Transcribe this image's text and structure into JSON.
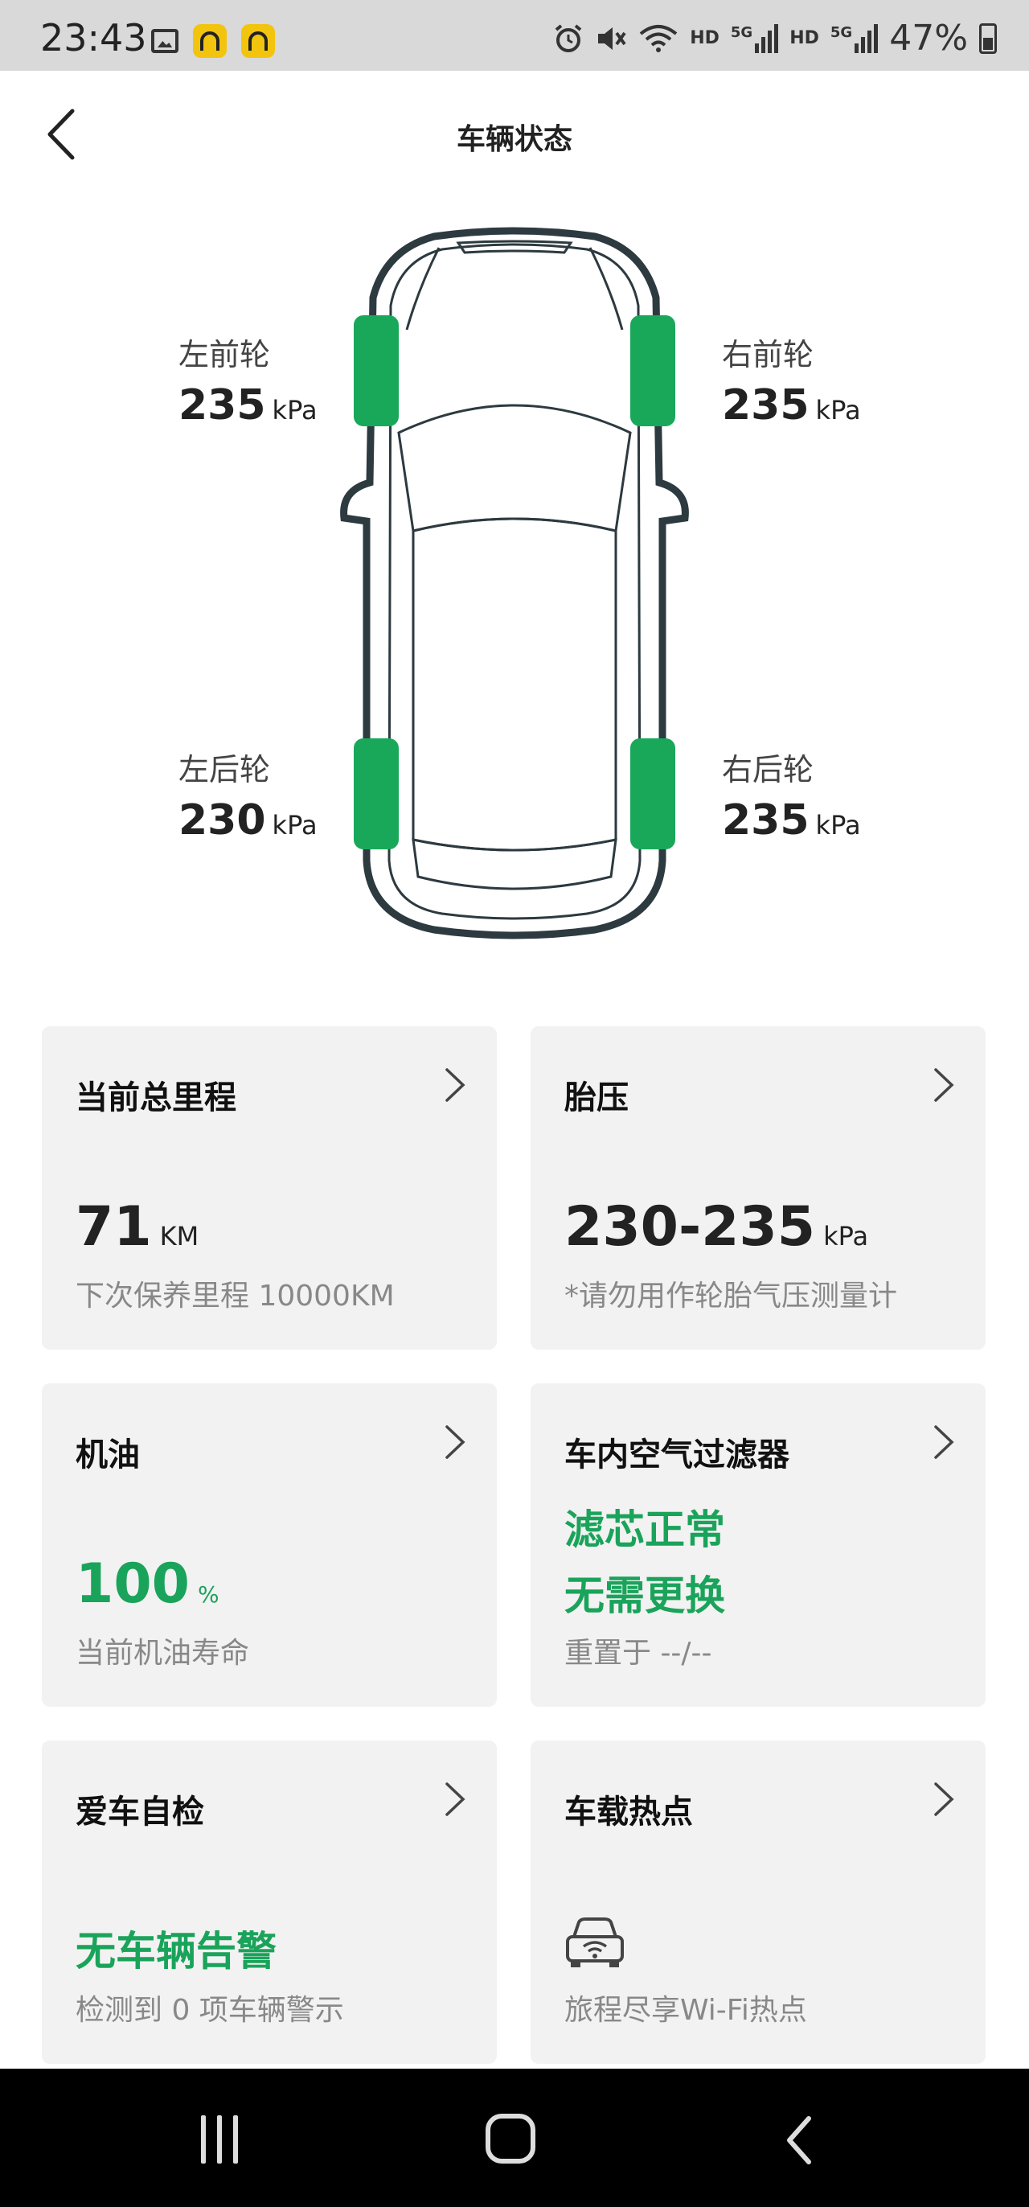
{
  "status_bar": {
    "time": "23:43",
    "hd1": "HD",
    "net1": "5G",
    "hd2": "HD",
    "net2": "5G",
    "battery": "47%"
  },
  "header": {
    "title": "车辆状态"
  },
  "tires": {
    "front_left": {
      "label": "左前轮",
      "value": "235",
      "unit": "kPa"
    },
    "front_right": {
      "label": "右前轮",
      "value": "235",
      "unit": "kPa"
    },
    "rear_left": {
      "label": "左后轮",
      "value": "230",
      "unit": "kPa"
    },
    "rear_right": {
      "label": "右后轮",
      "value": "235",
      "unit": "kPa"
    }
  },
  "cards": {
    "mileage": {
      "title": "当前总里程",
      "value": "71",
      "unit": "KM",
      "sub": "下次保养里程  10000KM"
    },
    "tire_pressure": {
      "title": "胎压",
      "value": "230-235",
      "unit": "kPa",
      "sub": "*请勿用作轮胎气压测量计"
    },
    "oil": {
      "title": "机油",
      "value": "100",
      "unit": "%",
      "sub": "当前机油寿命"
    },
    "air_filter": {
      "title": "车内空气过滤器",
      "line1": "滤芯正常",
      "line2": "无需更换",
      "sub": "重置于 --/--"
    },
    "self_check": {
      "title": "爱车自检",
      "status": "无车辆告警",
      "sub": "检测到 0 项车辆警示"
    },
    "hotspot": {
      "title": "车载热点",
      "sub": "旅程尽享Wi-Fi热点"
    }
  },
  "colors": {
    "accent_green": "#1aa35a",
    "tire_green": "#19a85a",
    "card_bg": "#f2f2f2"
  }
}
